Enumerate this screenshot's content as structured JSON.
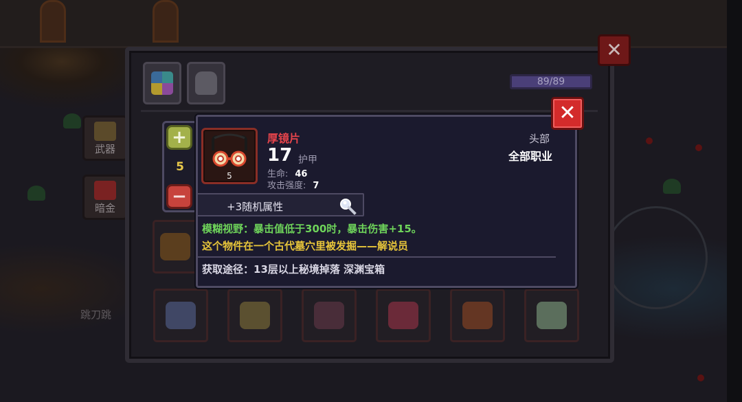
{
  "background": {
    "side_tabs": [
      {
        "label": "武器",
        "icon": "weapon-icon"
      },
      {
        "label": "暗金",
        "icon": "dark-gold-icon"
      }
    ],
    "ground_text": "跳刀跳"
  },
  "panel": {
    "tabs": [
      {
        "icon": "equipment-tab-icon"
      },
      {
        "icon": "pet-tab-icon"
      }
    ],
    "capacity": "89/89",
    "close_icon": "close-icon"
  },
  "tooltip": {
    "quantity": "5",
    "plus_label": "+",
    "minus_label": "−",
    "item": {
      "name": "厚镜片",
      "level": "5",
      "armor_value": "17",
      "armor_label": "护甲",
      "stats": [
        {
          "label": "生命:",
          "value": "46"
        },
        {
          "label": "攻击强度:",
          "value": "7"
        }
      ],
      "slot_type": "头部",
      "class_requirement": "全部职业",
      "icon": "glasses-icon"
    },
    "affix_label": "+3随机属性",
    "affix_icon": "magnifier-icon",
    "effect_text": "模糊视野：暴击值低于300时，暴击伤害+15。",
    "flavor_text": "这个物件在一个古代墓穴里被发掘——解说员",
    "source_text": "获取途径：13层以上秘境掉落 深渊宝箱",
    "close_label": "✕"
  },
  "colors": {
    "item_name": "#e6444b",
    "effect": "#6ed35a",
    "flavor": "#e7c53a",
    "quantity": "#e8c84a",
    "close_button": "#d32b2b"
  }
}
